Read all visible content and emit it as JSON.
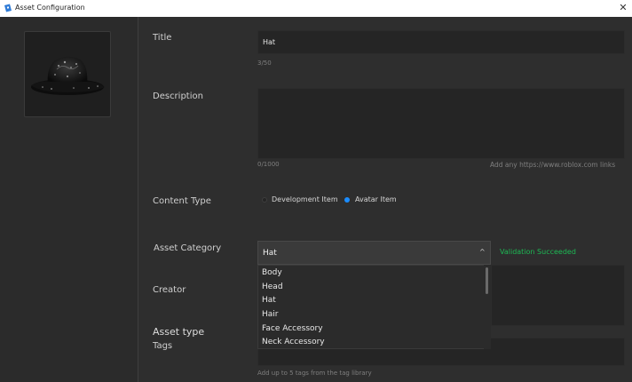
{
  "window": {
    "title": "Asset Configuration",
    "close_glyph": "✕",
    "icon": "roblox-studio-icon"
  },
  "preview": {
    "image": "hat-thumbnail"
  },
  "form": {
    "title_label": "Title",
    "title_value": "Hat",
    "title_counter": "3/50",
    "description_label": "Description",
    "description_value": "",
    "description_counter": "0/1000",
    "description_hint": "Add any https://www.roblox.com links",
    "content_type_label": "Content Type",
    "content_type_options": [
      {
        "label": "Development Item",
        "selected": false
      },
      {
        "label": "Avatar Item",
        "selected": true
      }
    ],
    "asset_category_label": "Asset Category",
    "asset_category_value": "Hat",
    "asset_category_options": [
      "Body",
      "Head",
      "Hat",
      "Hair",
      "Face Accessory",
      "Neck Accessory"
    ],
    "validation_text": "Validation Succeeded",
    "creator_label": "Creator",
    "asset_type_label": "Asset type",
    "tags_label": "Tags",
    "tags_hint": "Add up to 5 tags from the tag library"
  },
  "colors": {
    "accent": "#1a8cff",
    "success": "#1db954",
    "background": "#2e2e2e"
  }
}
